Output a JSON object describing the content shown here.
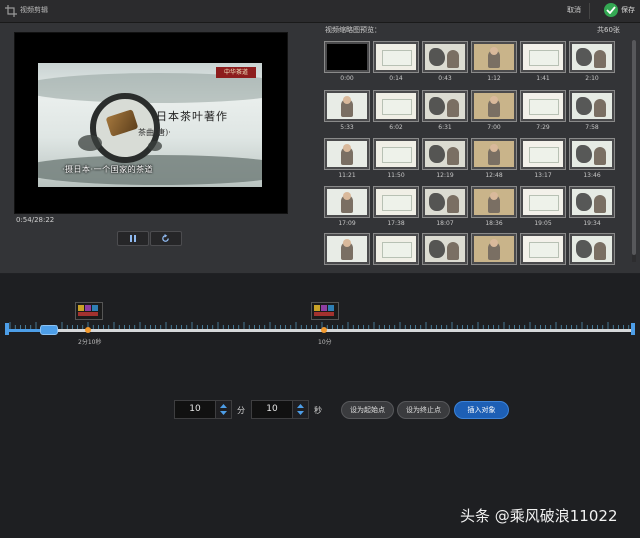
{
  "window": {
    "title": "视频剪辑",
    "cancel_label": "取消",
    "save_label": "保存"
  },
  "player": {
    "seal_text": "中华茶道",
    "title_text": "日本茶叶著作",
    "sub_text": "茶曲(唐)·",
    "caption_text": "·摄日本·一个国家的茶道",
    "time_label": "0:54/28:22"
  },
  "thumbnails": {
    "header": "视频缩略图预览：",
    "count_label": "共60张",
    "times": [
      "0:00",
      "0:14",
      "0:43",
      "1:12",
      "1:41",
      "2:10",
      "5:33",
      "6:02",
      "6:31",
      "7:00",
      "7:29",
      "7:58",
      "11:21",
      "11:50",
      "12:19",
      "12:48",
      "13:17",
      "13:46",
      "17:09",
      "17:38",
      "18:07",
      "18:36",
      "19:05",
      "19:34",
      "",
      "",
      "",
      "",
      "",
      ""
    ]
  },
  "timeline": {
    "marker_a_label": "2分10秒",
    "marker_b_label": "10分",
    "progress_fraction": 0.058
  },
  "controls": {
    "minutes_value": "10",
    "minutes_unit": "分",
    "seconds_value": "10",
    "seconds_unit": "秒",
    "set_start_label": "设为起始点",
    "set_end_label": "设为终止点",
    "insert_label": "插入对象"
  },
  "watermark": "头条 @乘风破浪11022",
  "colors": {
    "accent": "#4d9ee8",
    "primary_button": "#1d5fb5",
    "save_check": "#34a853",
    "pin": "#f29a2e"
  }
}
